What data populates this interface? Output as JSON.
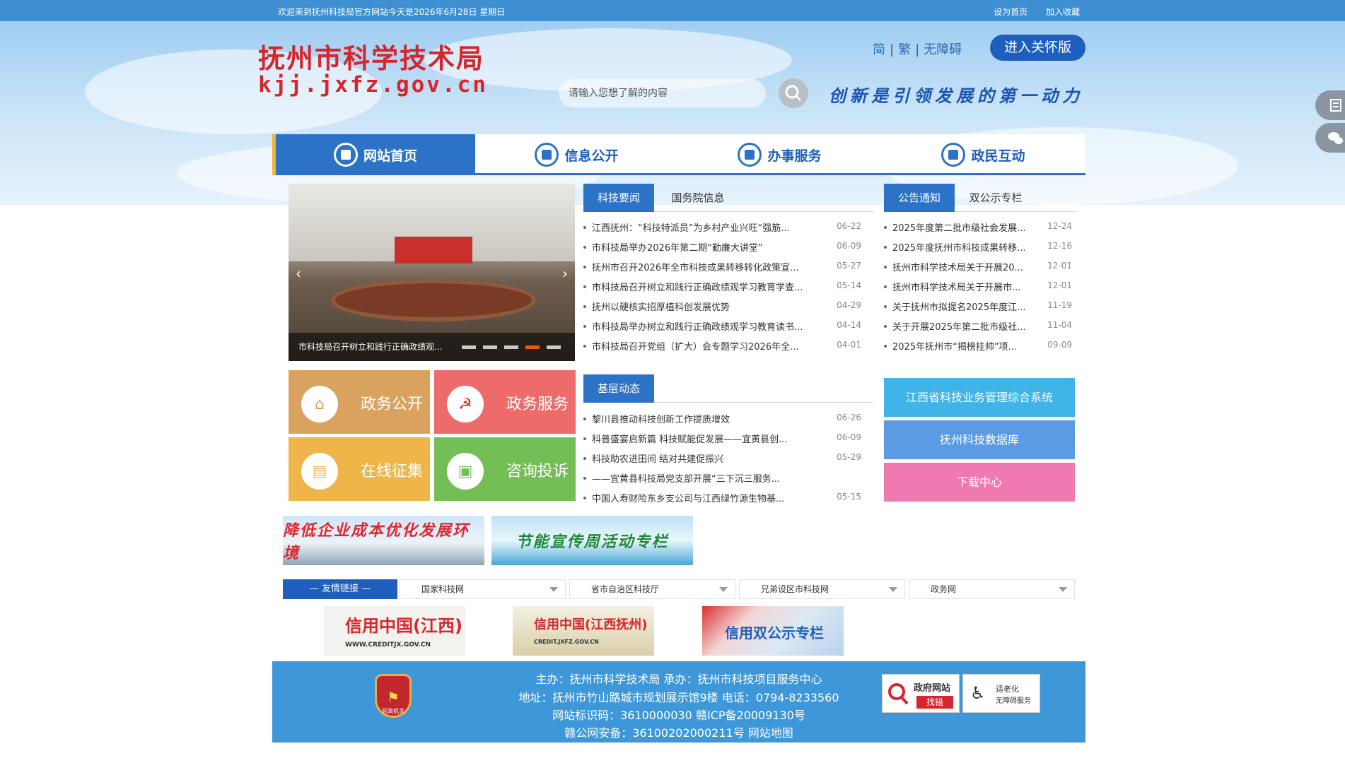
{
  "topbar": {
    "welcome": "欢迎来到抚州科技局官方网站今天是2026年6月28日 星期日",
    "set_home": "设为首页",
    "add_fav": "加入收藏"
  },
  "header": {
    "logo_cn": "抚州市科学技术局",
    "logo_en": "kjj.jxfz.gov.cn",
    "lang_simplified": "简",
    "lang_traditional": "繁",
    "accessibility": "无障碍",
    "care_version": "进入关怀版",
    "search_placeholder": "请输入您想了解的内容",
    "slogan": "创新是引领发展的第一动力"
  },
  "nav": [
    {
      "label": "网站首页",
      "icon": "home-icon"
    },
    {
      "label": "信息公开",
      "icon": "document-icon"
    },
    {
      "label": "办事服务",
      "icon": "hand-icon"
    },
    {
      "label": "政民互动",
      "icon": "chat-icon"
    }
  ],
  "slider": {
    "caption": "市科技局召开树立和践行正确政绩观..."
  },
  "news": {
    "tabs": [
      "科技要闻",
      "国务院信息"
    ],
    "items": [
      {
        "title": "江西抚州：“科技特派员”为乡村产业兴旺“强筋...",
        "date": "06-22"
      },
      {
        "title": "市科技局举办2026年第二期“勤廉大讲堂”",
        "date": "06-09"
      },
      {
        "title": "抚州市召开2026年全市科技成果转移转化政策宣...",
        "date": "05-27"
      },
      {
        "title": "市科技局召开树立和践行正确政绩观学习教育学查...",
        "date": "05-14"
      },
      {
        "title": "抚州以硬核实招厚植科创发展优势",
        "date": "04-29"
      },
      {
        "title": "市科技局举办树立和践行正确政绩观学习教育读书...",
        "date": "04-14"
      },
      {
        "title": "市科技局召开党组（扩大）会专题学习2026年全...",
        "date": "04-01"
      }
    ]
  },
  "notices": {
    "tabs": [
      "公告通知",
      "双公示专栏"
    ],
    "items": [
      {
        "title": "2025年度第二批市级社会发展...",
        "date": "12-24"
      },
      {
        "title": "2025年度抚州市科技成果转移...",
        "date": "12-16"
      },
      {
        "title": "抚州市科学技术局关于开展20...",
        "date": "12-01"
      },
      {
        "title": "抚州市科学技术局关于开展市...",
        "date": "12-01"
      },
      {
        "title": "关于抚州市拟提名2025年度江...",
        "date": "11-19"
      },
      {
        "title": "关于开展2025年第二批市级社...",
        "date": "11-04"
      },
      {
        "title": "2025年抚州市“揭榜挂帅”项...",
        "date": "09-09"
      }
    ]
  },
  "tiles": [
    {
      "label": "政务公开",
      "icon": "building-icon",
      "color": "#d9a25e"
    },
    {
      "label": "政务服务",
      "icon": "party-emblem-icon",
      "color": "#ee6b6b"
    },
    {
      "label": "在线征集",
      "icon": "form-icon",
      "color": "#f0b548"
    },
    {
      "label": "咨询投诉",
      "icon": "message-icon",
      "color": "#73bf55"
    }
  ],
  "grassroots": {
    "tab": "基层动态",
    "items": [
      {
        "title": "黎川县推动科技创新工作提质增效",
        "date": "06-26"
      },
      {
        "title": "科普盛宴启新篇 科技赋能促发展——宜黄县创...",
        "date": "06-09"
      },
      {
        "title": "科技助农进田间 结对共建促振兴",
        "date": "05-29"
      },
      {
        "title": "——宜黄县科技局党支部开展“三下沉三服务...",
        "date": ""
      },
      {
        "title": "中国人寿财险东乡支公司与江西绿竹源生物基...",
        "date": "05-15"
      }
    ]
  },
  "quick_links": [
    {
      "label": "江西省科技业务管理综合系统",
      "color": "#3fb4e8"
    },
    {
      "label": "抚州科技数据库",
      "color": "#5b9be3"
    },
    {
      "label": "下载中心",
      "color": "#ef79b0"
    }
  ],
  "promos": [
    {
      "label": "降低企业成本优化发展环境"
    },
    {
      "label": "节能宣传周活动专栏"
    }
  ],
  "friend_links": {
    "label": "— 友情链接 —",
    "selects": [
      "国家科技网",
      "省市自治区科技厅",
      "兄弟设区市科技网",
      "政务网"
    ]
  },
  "credit_banners": [
    {
      "label": "信用中国(江西)",
      "sub": "WWW.CREDITJX.GOV.CN"
    },
    {
      "label": "信用中国(江西抚州)",
      "sub": "CREDIT.JXFZ.GOV.CN"
    },
    {
      "label": "信用双公示专栏",
      "sub": ""
    }
  ],
  "footer": {
    "line1": "主办：抚州市科学技术局 承办：抚州市科技项目服务中心",
    "line2": "地址：抚州市竹山路城市规划展示馆9楼 电话：0794-8233560",
    "line3": "网站标识码：3610000030 赣ICP备20009130号",
    "line4": "赣公网安备：36100202000211号 网站地图",
    "emblem_text": "党政机关",
    "gov_error": "政府网站",
    "gov_error_sub": "找错",
    "elder": "适老化",
    "elder_sub": "无障碍服务"
  }
}
